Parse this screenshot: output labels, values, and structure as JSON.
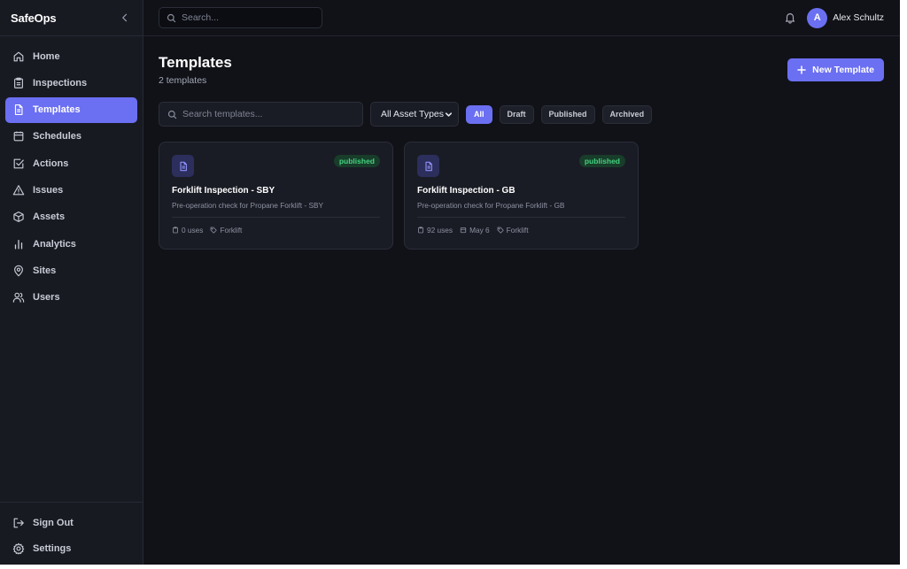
{
  "brand": {
    "name": "SafeOps"
  },
  "sidebar": {
    "items": [
      {
        "label": "Home",
        "icon": "home-icon"
      },
      {
        "label": "Inspections",
        "icon": "clipboard-icon"
      },
      {
        "label": "Templates",
        "icon": "file-icon",
        "active": true
      },
      {
        "label": "Schedules",
        "icon": "calendar-icon"
      },
      {
        "label": "Actions",
        "icon": "check-square-icon"
      },
      {
        "label": "Issues",
        "icon": "warning-icon"
      },
      {
        "label": "Assets",
        "icon": "box-icon"
      },
      {
        "label": "Analytics",
        "icon": "bar-chart-icon"
      },
      {
        "label": "Sites",
        "icon": "map-pin-icon"
      },
      {
        "label": "Users",
        "icon": "users-icon"
      }
    ],
    "bottom": [
      {
        "label": "Sign Out",
        "icon": "sign-out-icon"
      },
      {
        "label": "Settings",
        "icon": "gear-icon"
      }
    ]
  },
  "topbar": {
    "search_placeholder": "Search...",
    "user_initial": "A",
    "user_name": "Alex Schultz"
  },
  "page": {
    "title": "Templates",
    "subtitle": "2 templates",
    "new_button_label": "New Template"
  },
  "filters": {
    "search_placeholder": "Search templates...",
    "asset_type_selected": "All Asset Types",
    "chips": [
      "All",
      "Draft",
      "Published",
      "Archived"
    ],
    "active_chip": "All"
  },
  "templates": [
    {
      "title": "Forklift Inspection - SBY",
      "description": "Pre-operation check for Propane Forklift - SBY",
      "status": "published",
      "uses": "0 uses",
      "tag": "Forklift"
    },
    {
      "title": "Forklift Inspection - GB",
      "description": "Pre-operation check for Propane Forklift - GB",
      "status": "published",
      "uses": "92 uses",
      "date": "May 6",
      "tag": "Forklift"
    }
  ],
  "colors": {
    "accent": "#6b6ff2",
    "background": "#111218",
    "sidebar": "#181a22",
    "card": "#1a1c25",
    "published_text": "#45d17f",
    "published_bg": "#183d2a"
  }
}
